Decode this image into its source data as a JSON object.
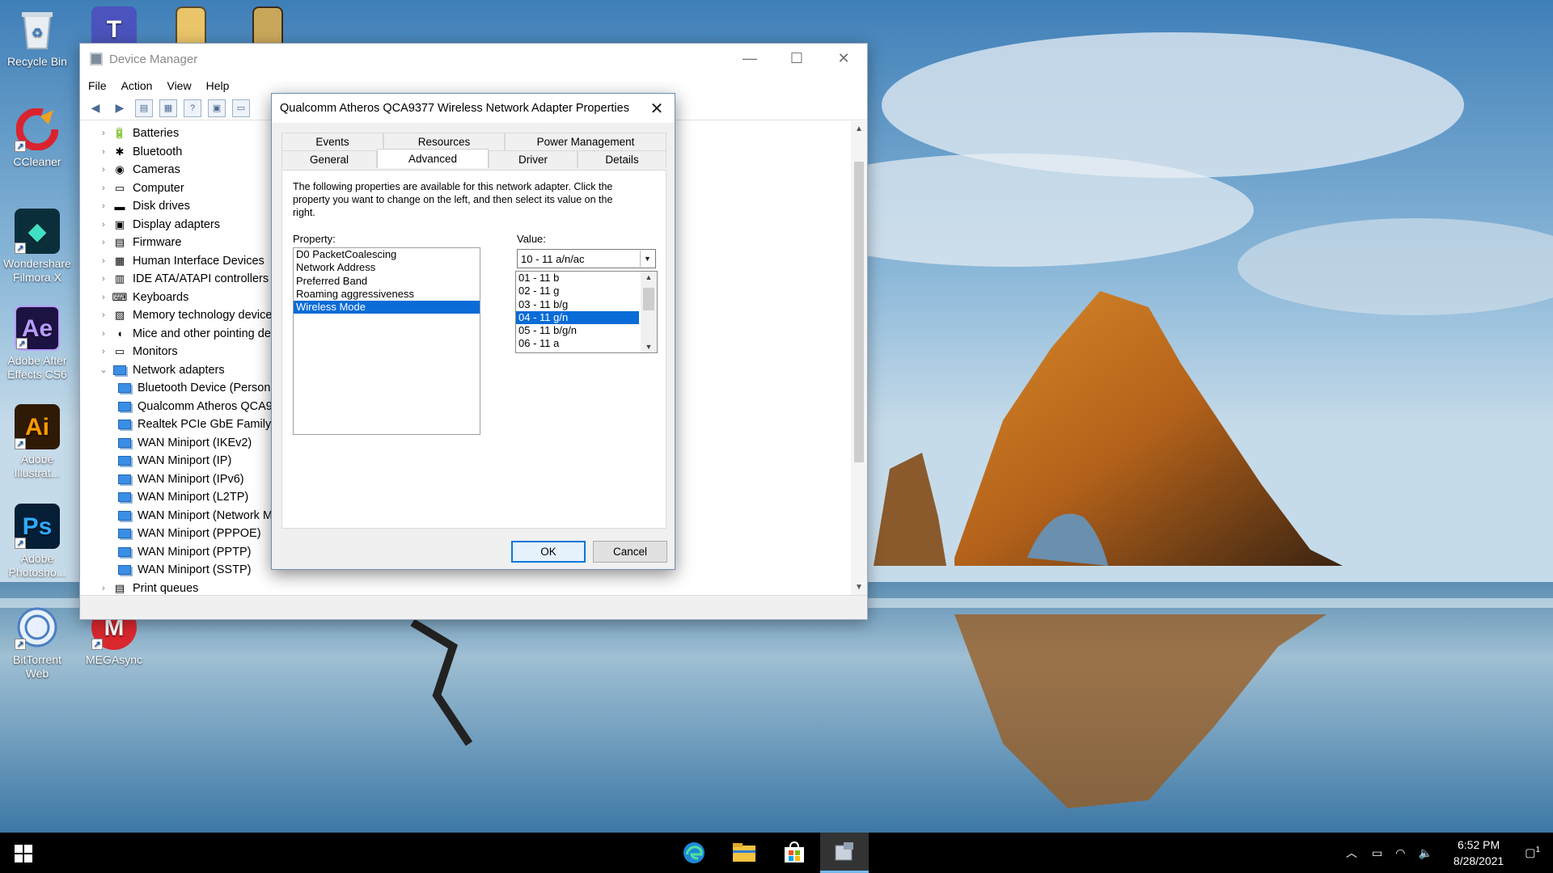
{
  "desktop": {
    "icons": [
      {
        "label": "Recycle Bin",
        "icon": "recycle-bin-icon"
      },
      {
        "label": "CCleaner",
        "icon": "ccleaner-icon"
      },
      {
        "label": "Wondershare Filmora X",
        "icon": "filmora-icon"
      },
      {
        "label": "Adobe After Effects CS6",
        "icon": "after-effects-icon",
        "glyph": "Ae"
      },
      {
        "label": "Adobe Illustrat...",
        "icon": "illustrator-icon",
        "glyph": "Ai"
      },
      {
        "label": "Adobe Photosho...",
        "icon": "photoshop-icon",
        "glyph": "Ps"
      },
      {
        "label": "BitTorrent Web",
        "icon": "bittorrent-icon"
      },
      {
        "label": "MEGAsync",
        "icon": "megasync-icon",
        "glyph": "M"
      }
    ],
    "top_row_icons": [
      "teams-icon",
      "folder-icon",
      "folder-icon"
    ],
    "teams_glyph": "T"
  },
  "device_manager": {
    "title": "Device Manager",
    "menu": [
      "File",
      "Action",
      "View",
      "Help"
    ],
    "tree": {
      "categories": [
        {
          "label": "Batteries",
          "icon": "battery-icon"
        },
        {
          "label": "Bluetooth",
          "icon": "bluetooth-icon"
        },
        {
          "label": "Cameras",
          "icon": "camera-icon"
        },
        {
          "label": "Computer",
          "icon": "computer-icon"
        },
        {
          "label": "Disk drives",
          "icon": "disk-drive-icon"
        },
        {
          "label": "Display adapters",
          "icon": "display-adapter-icon"
        },
        {
          "label": "Firmware",
          "icon": "firmware-icon"
        },
        {
          "label": "Human Interface Devices",
          "icon": "hid-icon"
        },
        {
          "label": "IDE ATA/ATAPI controllers",
          "icon": "ide-icon"
        },
        {
          "label": "Keyboards",
          "icon": "keyboard-icon"
        },
        {
          "label": "Memory technology devices",
          "icon": "memory-icon"
        },
        {
          "label": "Mice and other pointing devices",
          "icon": "mouse-icon"
        },
        {
          "label": "Monitors",
          "icon": "monitor-icon"
        }
      ],
      "expanded": {
        "label": "Network adapters",
        "children": [
          "Bluetooth Device (Personal Area Network)",
          "Qualcomm Atheros QCA9377 Wireless Network Adapter",
          "Realtek PCIe GbE Family Controller",
          "WAN Miniport (IKEv2)",
          "WAN Miniport (IP)",
          "WAN Miniport (IPv6)",
          "WAN Miniport (L2TP)",
          "WAN Miniport (Network Monitor)",
          "WAN Miniport (PPPOE)",
          "WAN Miniport (PPTP)",
          "WAN Miniport (SSTP)"
        ]
      },
      "after": "Print queues"
    }
  },
  "dialog": {
    "title": "Qualcomm Atheros QCA9377 Wireless Network Adapter Properties",
    "tabs_row1": [
      "Events",
      "Resources",
      "Power Management"
    ],
    "tabs_row2": [
      "General",
      "Advanced",
      "Driver",
      "Details"
    ],
    "active_tab": "Advanced",
    "description": "The following properties are available for this network adapter. Click the property you want to change on the left, and then select its value on the right.",
    "property_label": "Property:",
    "value_label": "Value:",
    "properties": [
      "D0 PacketCoalescing",
      "Network Address",
      "Preferred Band",
      "Roaming aggressiveness",
      "Wireless Mode"
    ],
    "selected_property": "Wireless Mode",
    "value_selected": "10 - 11 a/n/ac",
    "value_options": [
      "01 - 11 b",
      "02 - 11 g",
      "03 - 11 b/g",
      "04 - 11 g/n",
      "05 - 11 b/g/n",
      "06 - 11 a"
    ],
    "highlighted_option": "04 - 11 g/n",
    "ok_label": "OK",
    "cancel_label": "Cancel"
  },
  "taskbar": {
    "apps": [
      "edge-icon",
      "file-explorer-icon",
      "store-icon",
      "device-manager-icon"
    ],
    "time": "6:52 PM",
    "date": "8/28/2021",
    "notification_count": "1"
  }
}
